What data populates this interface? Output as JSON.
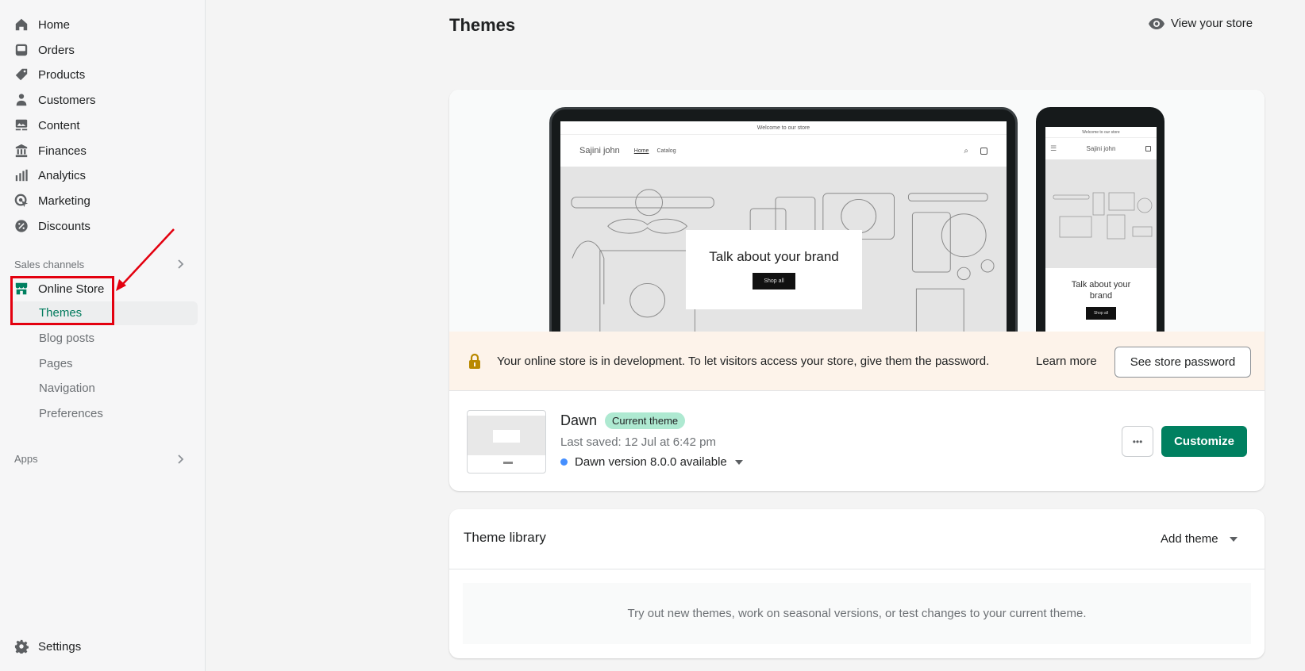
{
  "sidebar": {
    "items": [
      {
        "label": "Home",
        "icon": "home-icon"
      },
      {
        "label": "Orders",
        "icon": "inbox-icon"
      },
      {
        "label": "Products",
        "icon": "tag-icon"
      },
      {
        "label": "Customers",
        "icon": "person-icon"
      },
      {
        "label": "Content",
        "icon": "image-icon"
      },
      {
        "label": "Finances",
        "icon": "bank-icon"
      },
      {
        "label": "Analytics",
        "icon": "bar-chart-icon"
      },
      {
        "label": "Marketing",
        "icon": "target-icon"
      },
      {
        "label": "Discounts",
        "icon": "discount-icon"
      }
    ],
    "sales_channels_label": "Sales channels",
    "online_store": {
      "label": "Online Store",
      "icon": "store-icon"
    },
    "sub_items": [
      "Themes",
      "Blog posts",
      "Pages",
      "Navigation",
      "Preferences"
    ],
    "selected_sub_item": "Themes",
    "apps_label": "Apps",
    "settings_label": "Settings"
  },
  "header": {
    "title": "Themes",
    "view_store_label": "View your store"
  },
  "preview": {
    "announcement": "Welcome to our store",
    "store_name": "Sajini john",
    "nav": [
      "Home",
      "Catalog"
    ],
    "hero_heading": "Talk about your brand",
    "hero_button": "Shop all"
  },
  "banner": {
    "message": "Your online store is in development. To let visitors access your store, give them the password.",
    "learn_more": "Learn more",
    "button": "See store password"
  },
  "current_theme": {
    "name": "Dawn",
    "badge": "Current theme",
    "last_saved": "Last saved: 12 Jul at 6:42 pm",
    "update": "Dawn version 8.0.0 available",
    "more_label": "•••",
    "customize_label": "Customize"
  },
  "theme_library": {
    "title": "Theme library",
    "add_theme_label": "Add theme",
    "empty_text": "Try out new themes, work on seasonal versions, or test changes to your current theme."
  },
  "colors": {
    "accent": "#008060",
    "selected_text": "#007a5c",
    "banner_bg": "#fdf3ea",
    "badge_bg": "#aee9d1",
    "annotation_red": "#e3000f"
  }
}
